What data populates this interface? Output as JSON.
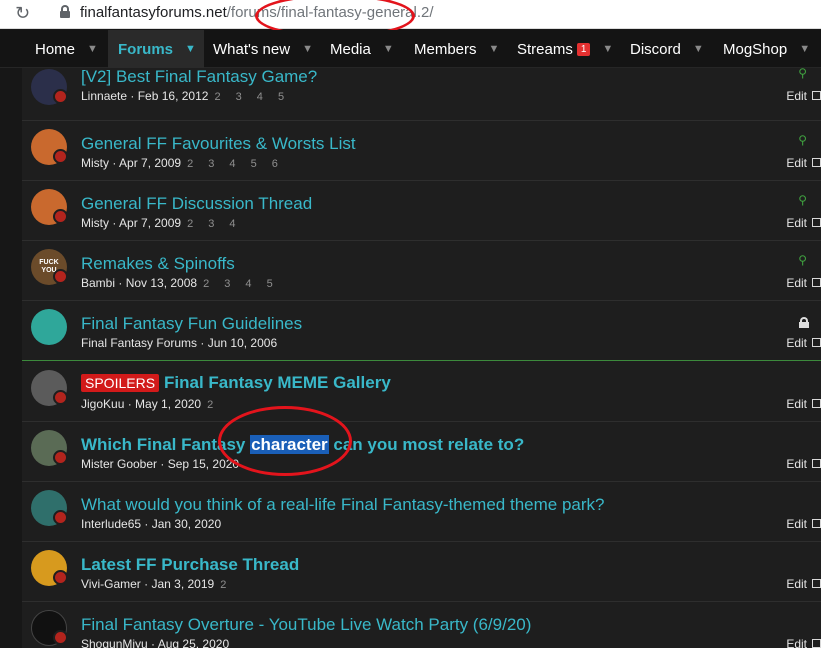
{
  "browser": {
    "url_host": "finalfantasyforums.net",
    "url_path": "/forums/final-fantasy-general.2/"
  },
  "nav": {
    "items": [
      {
        "label": "Home"
      },
      {
        "label": "Forums"
      },
      {
        "label": "What's new"
      },
      {
        "label": "Media"
      },
      {
        "label": "Members"
      },
      {
        "label": "Streams",
        "badge": "1"
      },
      {
        "label": "Discord"
      },
      {
        "label": "MogShop"
      }
    ]
  },
  "threads": [
    {
      "title": "[V2] Best Final Fantasy Game?",
      "author": "Linnaete",
      "date": "Feb 16, 2012",
      "pages": "2 3 4 5",
      "edit": "Edit",
      "avatar_color": "#2b2f4a"
    },
    {
      "title": "General FF Favourites & Worsts List",
      "author": "Misty",
      "date": "Apr 7, 2009",
      "pages": "2 3 4 5 6",
      "edit": "Edit",
      "avatar_color": "#c9692e"
    },
    {
      "title": "General FF Discussion Thread",
      "author": "Misty",
      "date": "Apr 7, 2009",
      "pages": "2 3 4",
      "edit": "Edit",
      "avatar_color": "#c9692e"
    },
    {
      "title": "Remakes & Spinoffs",
      "author": "Bambi",
      "date": "Nov 13, 2008",
      "pages": "2 3 4 5",
      "edit": "Edit",
      "avatar_color": "#6b4b2a",
      "avatar_text": "FUCK YOU"
    },
    {
      "title": "Final Fantasy Fun Guidelines",
      "author": "Final Fantasy Forums",
      "date": "Jun 10, 2006",
      "pages": "",
      "edit": "Edit",
      "avatar_color": "#2fa79a"
    },
    {
      "prefix": "SPOILERS",
      "title": "Final Fantasy MEME Gallery",
      "author": "JigoKuu",
      "date": "May 1, 2020",
      "pages": "2",
      "edit": "Edit",
      "avatar_color": "#5b5b5b"
    },
    {
      "title_before": "Which Final Fantasy ",
      "title_hl": "character",
      "title_after": " can you most relate to?",
      "author": "Mister Goober",
      "date": "Sep 15, 2020",
      "pages": "",
      "edit": "Edit",
      "avatar_color": "#5a6b55"
    },
    {
      "title": "What would you think of a real-life Final Fantasy-themed theme park?",
      "author": "Interlude65",
      "date": "Jan 30, 2020",
      "pages": "",
      "edit": "Edit",
      "avatar_color": "#2f6f6b"
    },
    {
      "title": "Latest FF Purchase Thread",
      "author": "Vivi-Gamer",
      "date": "Jan 3, 2019",
      "pages": "2",
      "edit": "Edit",
      "avatar_color": "#d79a1e"
    },
    {
      "title": "Final Fantasy Overture - YouTube Live Watch Party (6/9/20)",
      "author": "ShogunMiyu",
      "date": "Aug 25, 2020",
      "pages": "",
      "edit": "Edit",
      "avatar_color": "#111111"
    }
  ]
}
